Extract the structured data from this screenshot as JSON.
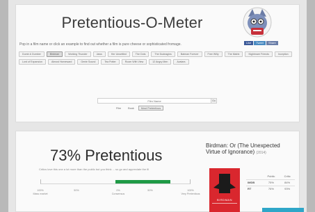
{
  "app": {
    "title": "Pretentious-O-Meter",
    "subtitle": "Pop in a film name or click an example to find out whether a film is pure cheese or sophisticated fromage."
  },
  "share": [
    {
      "label": "Like",
      "icon": "facebook-icon"
    },
    {
      "label": "Tweet",
      "icon": "twitter-icon"
    },
    {
      "label": "Share",
      "icon": "google-plus-icon"
    }
  ],
  "examples": [
    {
      "label": "Dumb & Dumber",
      "active": false
    },
    {
      "label": "Birdman",
      "active": true
    },
    {
      "label": "Working Thunder",
      "active": false
    },
    {
      "label": "Jaws",
      "active": false
    },
    {
      "label": "Her Unsettled",
      "active": false
    },
    {
      "label": "The Dots",
      "active": false
    },
    {
      "label": "The Dudeagins",
      "active": false
    },
    {
      "label": "Batman Forever",
      "active": false
    },
    {
      "label": "Free Willy",
      "active": false
    },
    {
      "label": "The Matrix",
      "active": false
    },
    {
      "label": "Nightmare Friends",
      "active": false
    },
    {
      "label": "Inception",
      "active": false
    },
    {
      "label": "Lord of Expansion",
      "active": false
    },
    {
      "label": "Almost Homeward",
      "active": false
    },
    {
      "label": "Genie Sound",
      "active": false
    },
    {
      "label": "Tea Potter",
      "active": false
    },
    {
      "label": "Room With View",
      "active": false
    },
    {
      "label": "12 Angry Men",
      "active": false
    },
    {
      "label": "Avatars",
      "active": false
    }
  ],
  "search": {
    "placeholder": "Film Name",
    "button": "Go"
  },
  "modes": [
    {
      "label": "Film",
      "active": false
    },
    {
      "label": "Book",
      "active": false
    },
    {
      "label": "Most Pretentious",
      "active": true
    }
  ],
  "result": {
    "headline": "73% Pretentious",
    "description": "Critics love this one a lot more than the public but you think ... so go and appreciate the fil",
    "score_percent": 73,
    "fill_color": "#1f9a46",
    "scale": [
      {
        "value": "100%",
        "label": "Mass market"
      },
      {
        "value": "50%",
        "label": ""
      },
      {
        "value": "0%",
        "label": "Consensus"
      },
      {
        "value": "50%",
        "label": ""
      },
      {
        "value": "100%",
        "label": "Very Pretentious"
      }
    ]
  },
  "film": {
    "title": "Birdman: Or (The Unexpected Virtue of Ignorance)",
    "year": "(2014)",
    "poster_label": "BIRDMAN",
    "score_headers": [
      "",
      "Public",
      "Critic"
    ],
    "scores": [
      {
        "source": "IMDB",
        "public": "75%",
        "critic": "84%"
      },
      {
        "source": "RT",
        "public": "76%",
        "critic": "93%"
      }
    ]
  },
  "colors": {
    "accent": "#1f9a46",
    "poster": "#d9272e",
    "corner_tab": "#2fa6c8"
  }
}
